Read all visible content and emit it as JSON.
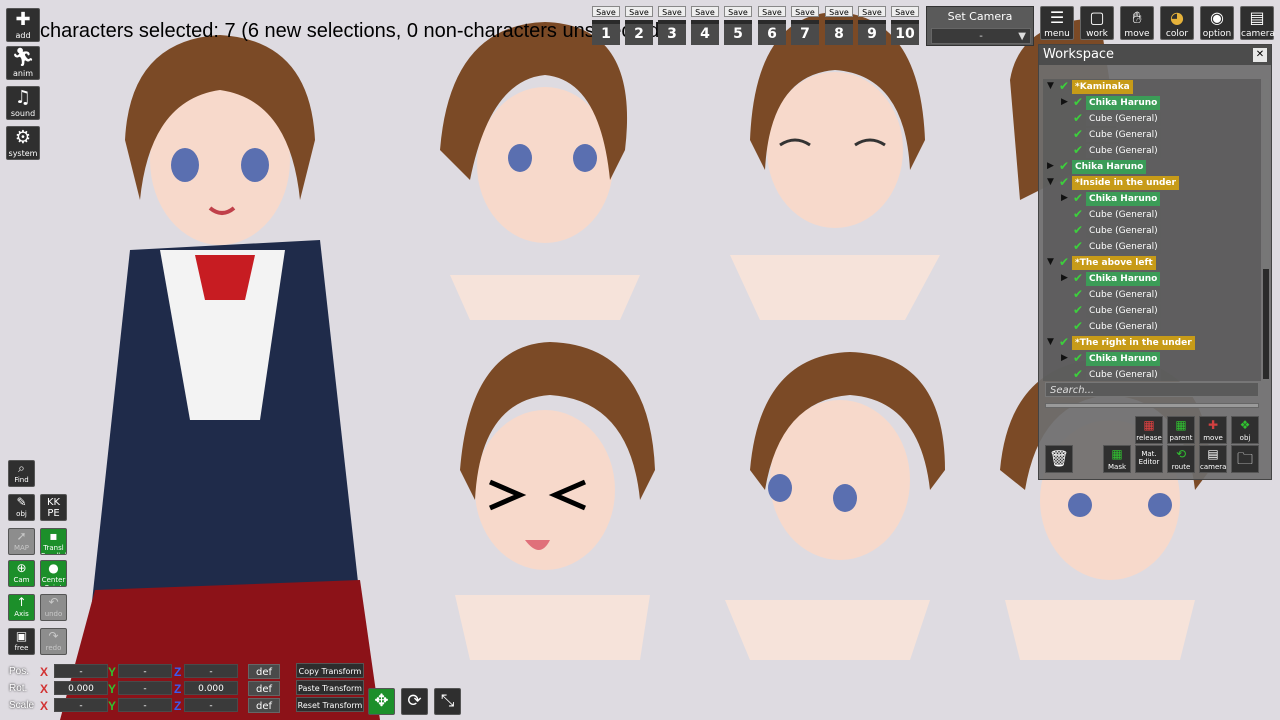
{
  "status": {
    "selection_text": "characters selected: 7 (6 new selections, 0 non-characters unselected)"
  },
  "left_menu": [
    {
      "name": "add",
      "label": "add",
      "icon": "plus-icon"
    },
    {
      "name": "anim",
      "label": "anim",
      "icon": "running-person-icon"
    },
    {
      "name": "sound",
      "label": "sound",
      "icon": "music-note-icon"
    },
    {
      "name": "system",
      "label": "system",
      "icon": "gears-icon"
    }
  ],
  "tools": {
    "find": "Find",
    "obj": "obj",
    "kkpe": "KK PE",
    "map": "MAP",
    "transl_parallel": "Transl Parallel",
    "cam": "Cam",
    "center_point": "Center Point",
    "axis": "Axis",
    "undo": "undo",
    "free": "free",
    "redo": "redo"
  },
  "transform": {
    "pos_label": "Pos.",
    "rot_label": "Rot.",
    "scale_label": "Scale",
    "axis_x": "X",
    "axis_y": "Y",
    "axis_z": "Z",
    "pos": {
      "x": "-",
      "y": "-",
      "z": "-"
    },
    "rot": {
      "x": "0.000",
      "y": "-",
      "z": "0.000"
    },
    "scale": {
      "x": "-",
      "y": "-",
      "z": "-"
    },
    "def_label": "def",
    "copy_label": "Copy Transform",
    "paste_label": "Paste Transform",
    "reset_label": "Reset Transform"
  },
  "save_slots": {
    "save_label": "Save",
    "slots": [
      "1",
      "2",
      "3",
      "4",
      "5",
      "6",
      "7",
      "8",
      "9",
      "10"
    ]
  },
  "camera": {
    "title": "Set Camera",
    "selected": "-"
  },
  "top_menu": [
    {
      "name": "menu",
      "label": "menu",
      "icon": "list-icon"
    },
    {
      "name": "work",
      "label": "work",
      "icon": "frame-icon"
    },
    {
      "name": "move",
      "label": "move",
      "icon": "hand-icon"
    },
    {
      "name": "color",
      "label": "color",
      "icon": "palette-icon"
    },
    {
      "name": "option",
      "label": "option",
      "icon": "eye-icon"
    },
    {
      "name": "camera",
      "label": "camera",
      "icon": "clapper-icon"
    }
  ],
  "workspace": {
    "title": "Workspace",
    "search_placeholder": "Search...",
    "tree": [
      {
        "level": 0,
        "type": "folder",
        "label": "*Kaminaka",
        "expanded": true
      },
      {
        "level": 1,
        "type": "char",
        "label": "Chika Haruno",
        "expanded": false
      },
      {
        "level": 1,
        "type": "item",
        "label": "Cube (General)"
      },
      {
        "level": 1,
        "type": "item",
        "label": "Cube (General)"
      },
      {
        "level": 1,
        "type": "item",
        "label": "Cube (General)"
      },
      {
        "level": 0,
        "type": "char",
        "label": "Chika Haruno",
        "expanded": false
      },
      {
        "level": 0,
        "type": "folder",
        "label": "*Inside in the under",
        "expanded": true
      },
      {
        "level": 1,
        "type": "char",
        "label": "Chika Haruno",
        "expanded": false
      },
      {
        "level": 1,
        "type": "item",
        "label": "Cube (General)"
      },
      {
        "level": 1,
        "type": "item",
        "label": "Cube (General)"
      },
      {
        "level": 1,
        "type": "item",
        "label": "Cube (General)"
      },
      {
        "level": 0,
        "type": "folder",
        "label": "*The above left",
        "expanded": true
      },
      {
        "level": 1,
        "type": "char",
        "label": "Chika Haruno",
        "expanded": false
      },
      {
        "level": 1,
        "type": "item",
        "label": "Cube (General)"
      },
      {
        "level": 1,
        "type": "item",
        "label": "Cube (General)"
      },
      {
        "level": 1,
        "type": "item",
        "label": "Cube (General)"
      },
      {
        "level": 0,
        "type": "folder",
        "label": "*The right in the under",
        "expanded": true
      },
      {
        "level": 1,
        "type": "char",
        "label": "Chika Haruno",
        "expanded": false
      },
      {
        "level": 1,
        "type": "item",
        "label": "Cube (General)"
      }
    ],
    "tools_row1": [
      {
        "name": "release",
        "label": "release"
      },
      {
        "name": "parent",
        "label": "parent"
      },
      {
        "name": "move-copy",
        "label": "move copy"
      },
      {
        "name": "obj-copy",
        "label": "obj copy"
      }
    ],
    "tools_row2": [
      {
        "name": "delete",
        "label": ""
      },
      {
        "name": "mask",
        "label": "Mask"
      },
      {
        "name": "mat-editor",
        "label": "Mat. Editor"
      },
      {
        "name": "route",
        "label": "route"
      },
      {
        "name": "camera",
        "label": "camera"
      },
      {
        "name": "folder",
        "label": ""
      }
    ]
  },
  "colors": {
    "background": "#dedbe1",
    "folder_chip": "#c79b18",
    "character_chip": "#3b9c57",
    "item_chip": "#5e5e5e",
    "active_tool_green": "#1c8f2a",
    "check_green": "#3cd03c",
    "axis_x": "#d23232",
    "axis_y": "#30c030",
    "axis_z": "#3a5cf0"
  }
}
